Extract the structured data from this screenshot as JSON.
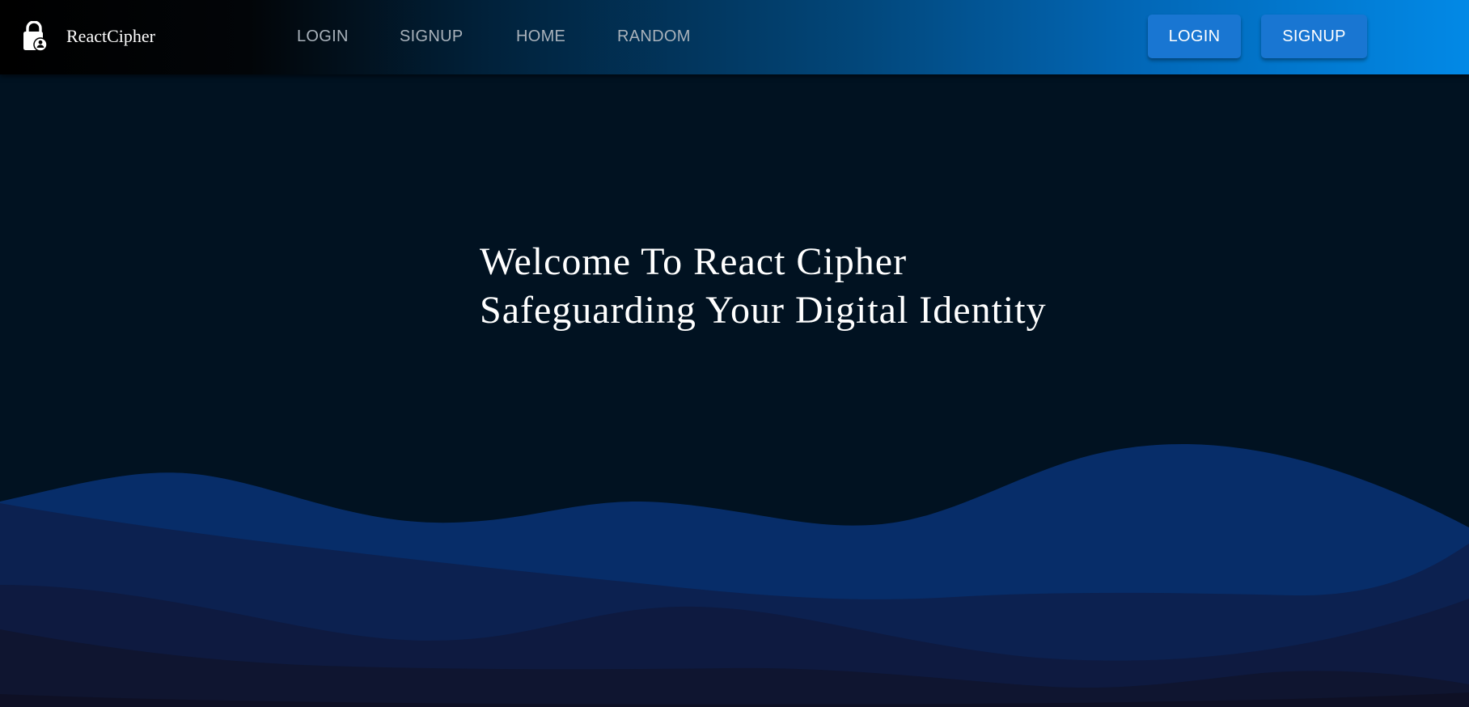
{
  "brand": {
    "icon": "lock-person-icon",
    "name": "ReactCipher"
  },
  "nav": {
    "links": [
      "LOGIN",
      "SIGNUP",
      "HOME",
      "RANDOM"
    ],
    "buttons": {
      "login": "LOGIN",
      "signup": "SIGNUP"
    }
  },
  "hero": {
    "line1": "Welcome To React Cipher",
    "line2": "Safeguarding Your Digital Identity"
  },
  "colors": {
    "background": "#011221",
    "button": "#1976d2",
    "nav_link": "#a9b2bb",
    "wave_1": "#072d69",
    "wave_2": "#0c2150",
    "wave_3": "#0e1a40",
    "wave_4": "#0f1530",
    "wave_5": "#0e1025"
  }
}
